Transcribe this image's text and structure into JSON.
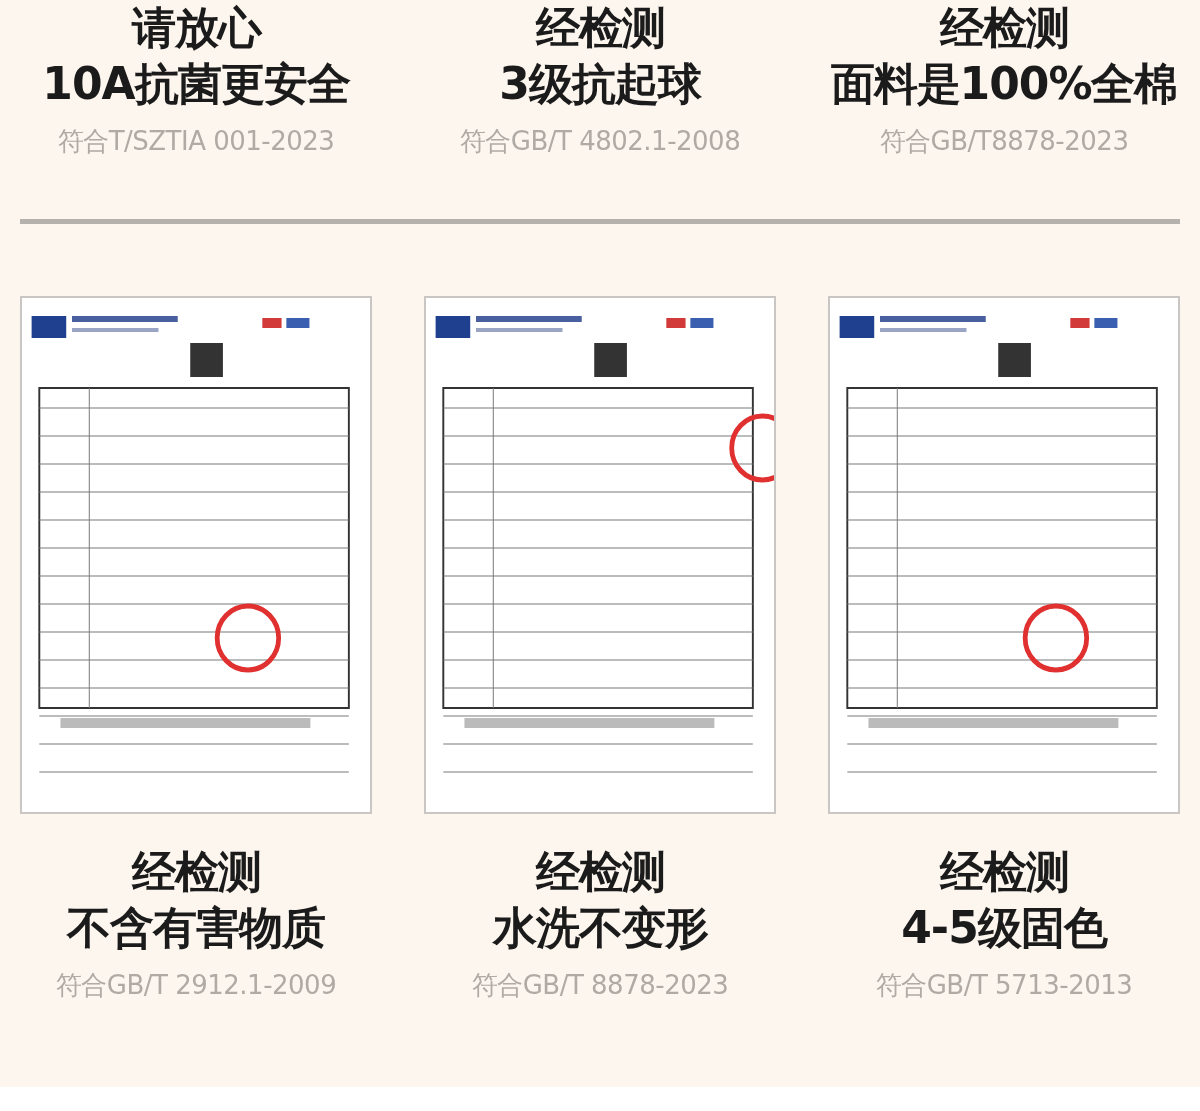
{
  "top_features": [
    {
      "line1": "请放心",
      "line2": "10A抗菌更安全",
      "standard": "符合T/SZTIA 001-2023"
    },
    {
      "line1": "经检测",
      "line2": "3级抗起球",
      "standard": "符合GB/T 4802.1-2008"
    },
    {
      "line1": "经检测",
      "line2": "面料是100%全棉",
      "standard": "符合GB/T8878-2023"
    }
  ],
  "bottom_features": [
    {
      "line1": "经检测",
      "line2": "不含有害物质",
      "standard": "符合GB/T 2912.1-2009"
    },
    {
      "line1": "经检测",
      "line2": "水洗不变形",
      "standard": "符合GB/T 8878-2023"
    },
    {
      "line1": "经检测",
      "line2": "4-5级固色",
      "standard": "符合GB/T 5713-2013"
    }
  ]
}
